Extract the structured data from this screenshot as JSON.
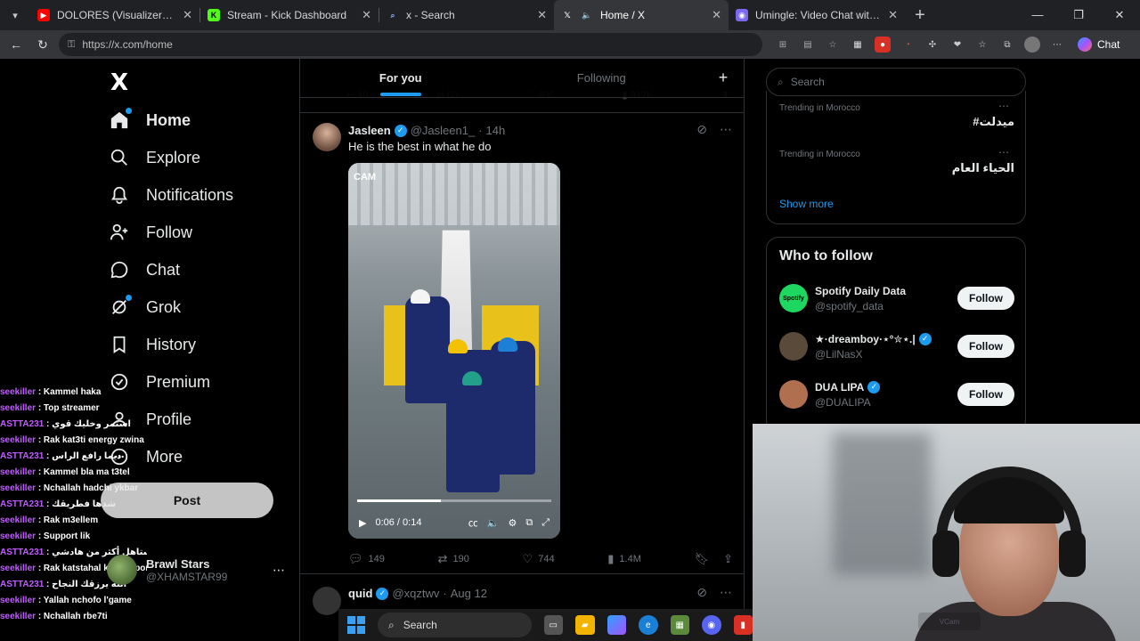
{
  "browser": {
    "tabs": [
      {
        "title": "DOLORES (Visualizer) - YouTube",
        "favicon": "youtube-icon",
        "color": "#ff0000",
        "active": false
      },
      {
        "title": "Stream - Kick Dashboard",
        "favicon": "kick-icon",
        "color": "#53fc18",
        "active": false
      },
      {
        "title": "x - Search",
        "favicon": "search-icon",
        "color": "#8ab4f8",
        "active": false
      },
      {
        "title": "Home / X",
        "favicon": "x-icon",
        "color": "#ffffff",
        "active": true
      },
      {
        "title": "Umingle: Video Chat with Stra",
        "favicon": "umingle-icon",
        "color": "#7b68ee",
        "active": false
      }
    ],
    "url": "https://x.com/home",
    "chat_label": "Chat"
  },
  "nav": {
    "logo": "X",
    "items": [
      {
        "label": "Home",
        "icon": "home-icon"
      },
      {
        "label": "Explore",
        "icon": "search-icon"
      },
      {
        "label": "Notifications",
        "icon": "bell-icon"
      },
      {
        "label": "Follow",
        "icon": "person-plus-icon"
      },
      {
        "label": "Chat",
        "icon": "chat-bubble-icon"
      },
      {
        "label": "Grok",
        "icon": "grok-icon"
      },
      {
        "label": "History",
        "icon": "bookmark-icon"
      },
      {
        "label": "Premium",
        "icon": "verified-badge-icon"
      },
      {
        "label": "Profile",
        "icon": "person-icon"
      },
      {
        "label": "More",
        "icon": "more-circle-icon"
      }
    ],
    "post_label": "Post",
    "account": {
      "name": "Brawl Stars",
      "handle": "@XHAMSTAR99"
    }
  },
  "stream_chat": [
    {
      "user": "seekiller",
      "msg": "Kammel haka"
    },
    {
      "user": "seekiller",
      "msg": "Top streamer"
    },
    {
      "user": "ASTTA231",
      "msg": "استمر وخليك قوي"
    },
    {
      "user": "seekiller",
      "msg": "Rak kat3ti energy zwina"
    },
    {
      "user": "ASTTA231",
      "msg": "ديما رافع الراس"
    },
    {
      "user": "seekiller",
      "msg": "Kammel bla ma t3tel"
    },
    {
      "user": "seekiller",
      "msg": "Nchallah hadchi ykbar"
    },
    {
      "user": "ASTTA231",
      "msg": "شدها فطريقك"
    },
    {
      "user": "seekiller",
      "msg": "Rak m3ellem"
    },
    {
      "user": "seekiller",
      "msg": "Support lik"
    },
    {
      "user": "ASTTA231",
      "msg": "تستاهل أكثر من هادشي"
    },
    {
      "user": "seekiller",
      "msg": "Rak katstahal kol support"
    },
    {
      "user": "ASTTA231",
      "msg": "الله يرزقك النجاح"
    },
    {
      "user": "seekiller",
      "msg": "Yallah nchofo l'game"
    },
    {
      "user": "seekiller",
      "msg": "Nchallah rbe7ti"
    }
  ],
  "feed": {
    "tabs": [
      "For you",
      "Following"
    ],
    "tweet": {
      "name": "Jasleen",
      "handle": "@Jasleen1_",
      "time": "14h",
      "text": "He is the best in what he do",
      "video": {
        "overlay": "CAM",
        "time": "0:06 / 0:14",
        "progress": 0.43
      },
      "stats": {
        "replies": "149",
        "reposts": "190",
        "likes": "744",
        "views": "1.4M"
      }
    },
    "tweet2": {
      "name": "quid",
      "handle": "@xqztwv",
      "time": "Aug 12"
    }
  },
  "right": {
    "search_placeholder": "Search",
    "trends": [
      {
        "context": "Trending in Morocco",
        "name": "#ميدلت"
      },
      {
        "context": "Trending in Morocco",
        "name": "الحياء العام"
      }
    ],
    "show_more": "Show more",
    "who_to_follow": {
      "title": "Who to follow",
      "follow_label": "Follow",
      "items": [
        {
          "name": "Spotify Daily Data",
          "handle": "@spotify_data",
          "verified": false,
          "avatar_color": "#1ed760"
        },
        {
          "name": "★·dreamboy·⋆°✮⋆.|",
          "handle": "@LilNasX",
          "verified": true,
          "avatar_color": "#5a4a3a"
        },
        {
          "name": "DUA LIPA",
          "handle": "@DUALIPA",
          "verified": true,
          "avatar_color": "#b0704f"
        }
      ]
    }
  },
  "taskbar": {
    "search_label": "Search"
  }
}
